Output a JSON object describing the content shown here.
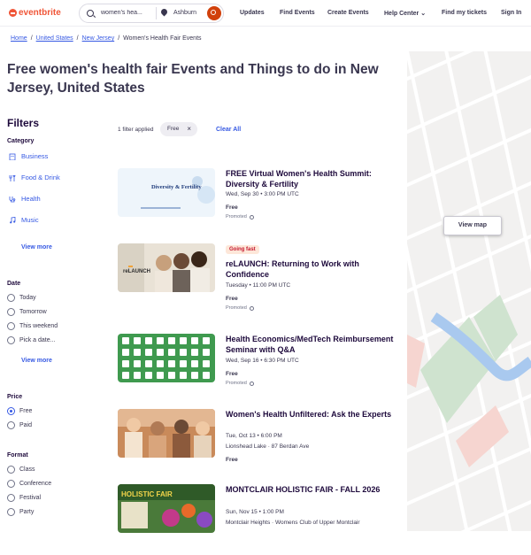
{
  "brand": {
    "logo": "eventbrite",
    "accent": "#f05537"
  },
  "search": {
    "query": "women's hea...",
    "location": "Ashburn"
  },
  "nav": {
    "updates": "Updates",
    "find": "Find Events",
    "create": "Create Events",
    "help": "Help Center",
    "tickets": "Find my tickets",
    "signin": "Sign In"
  },
  "breadcrumbs": [
    "Home",
    "United States",
    "New Jersey",
    "Women's Health Fair Events"
  ],
  "page_title": "Free women's health fair Events and Things to do in New Jersey, United States",
  "filters": {
    "heading": "Filters",
    "category_label": "Category",
    "categories": [
      "Business",
      "Food & Drink",
      "Health",
      "Music"
    ],
    "view_more": "View more",
    "date_label": "Date",
    "dates": [
      "Today",
      "Tomorrow",
      "This weekend",
      "Pick a date..."
    ],
    "date_view_more": "View more",
    "price_label": "Price",
    "prices": [
      "Free",
      "Paid"
    ],
    "price_selected": "Free",
    "format_label": "Format",
    "formats": [
      "Class",
      "Conference",
      "Festival",
      "Party"
    ]
  },
  "applied": {
    "text": "1 filter applied",
    "chip": "Free",
    "clear": "Clear All"
  },
  "map": {
    "button": "View map"
  },
  "events": [
    {
      "title": "FREE Virtual Women's Health Summit: Diversity & Fertility",
      "when": "Wed, Sep 30 • 3:00 PM UTC",
      "price": "Free",
      "promoted": "Promoted",
      "image_text": "Diversity & Fertility"
    },
    {
      "badge": "Going fast",
      "title": "reLAUNCH: Returning to Work with Confidence",
      "when": "Tuesday • 11:00 PM UTC",
      "price": "Free",
      "promoted": "Promoted",
      "image_text": "reLAUNCH"
    },
    {
      "title": "Health Economics/MedTech Reimbursement Seminar with Q&A",
      "when": "Wed, Sep 16 • 6:30 PM UTC",
      "price": "Free",
      "promoted": "Promoted"
    },
    {
      "title": "Women's Health Unfiltered: Ask the Experts",
      "when": "Tue, Oct 13 • 6:00 PM",
      "venue": "Lionshead Lake · 87 Berdan Ave",
      "price": "Free"
    },
    {
      "title": "MONTCLAIR HOLISTIC FAIR - FALL 2026",
      "when": "Sun, Nov 15 • 1:00 PM",
      "venue": "Montclair Heights · Womens Club of Upper Montclair",
      "image_text": "HOLISTIC FAIR"
    }
  ]
}
